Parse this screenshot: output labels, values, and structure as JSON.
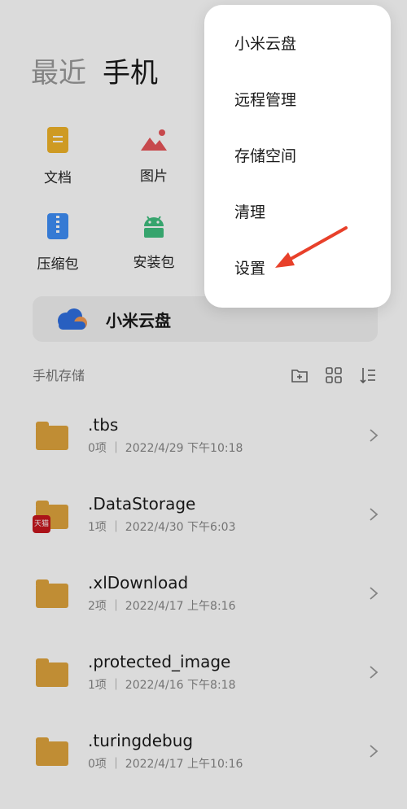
{
  "tabs": [
    {
      "label": "最近",
      "active": false
    },
    {
      "label": "手机",
      "active": true
    }
  ],
  "categories": [
    {
      "label": "文档",
      "icon": "document-icon"
    },
    {
      "label": "图片",
      "icon": "image-icon"
    },
    {
      "label": "压缩包",
      "icon": "archive-icon"
    },
    {
      "label": "安装包",
      "icon": "android-icon"
    }
  ],
  "cloud": {
    "label": "小米云盘",
    "icon": "cloud-icon"
  },
  "section": {
    "title": "手机存储",
    "tools": [
      "new-folder-icon",
      "grid-view-icon",
      "sort-icon"
    ]
  },
  "folders": [
    {
      "name": ".tbs",
      "meta": "0项 ｜ 2022/4/29 下午10:18",
      "badge": ""
    },
    {
      "name": ".DataStorage",
      "meta": "1项 ｜ 2022/4/30 下午6:03",
      "badge": "天猫"
    },
    {
      "name": ".xlDownload",
      "meta": "2项 ｜ 2022/4/17 上午8:16",
      "badge": ""
    },
    {
      "name": ".protected_image",
      "meta": "1项 ｜ 2022/4/16 下午8:18",
      "badge": ""
    },
    {
      "name": ".turingdebug",
      "meta": "0项 ｜ 2022/4/17 上午10:16",
      "badge": ""
    }
  ],
  "menu": {
    "items": [
      "小米云盘",
      "远程管理",
      "存储空间",
      "清理",
      "设置"
    ],
    "highlighted": "设置"
  },
  "colors": {
    "folder": "#e0a53d",
    "annotation_arrow": "#e8402a",
    "overlay": "rgba(0,0,0,0.14)"
  }
}
